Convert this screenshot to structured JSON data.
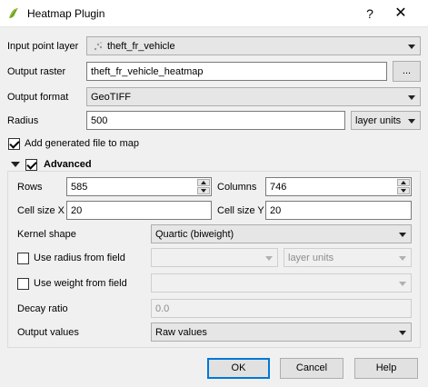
{
  "window": {
    "title": "Heatmap Plugin",
    "help_glyph": "?",
    "close_glyph": "✕"
  },
  "input_layer": {
    "label": "Input point layer",
    "value": "theft_fr_vehicle"
  },
  "output_raster": {
    "label": "Output raster",
    "value": "theft_fr_vehicle_heatmap",
    "browse_label": "..."
  },
  "output_format": {
    "label": "Output format",
    "value": "GeoTIFF"
  },
  "radius": {
    "label": "Radius",
    "value": "500",
    "unit": "layer units"
  },
  "add_to_map": {
    "label": "Add generated file to map",
    "checked": true
  },
  "advanced": {
    "title": "Advanced",
    "checked": true,
    "rows_label": "Rows",
    "rows_value": "585",
    "columns_label": "Columns",
    "columns_value": "746",
    "cellx_label": "Cell size X",
    "cellx_value": "20",
    "celly_label": "Cell size Y",
    "celly_value": "20",
    "kernel_label": "Kernel shape",
    "kernel_value": "Quartic (biweight)",
    "radius_field_label": "Use radius from field",
    "radius_field_checked": false,
    "radius_field_unit": "layer units",
    "weight_field_label": "Use weight from field",
    "weight_field_checked": false,
    "decay_label": "Decay ratio",
    "decay_value": "0.0",
    "output_values_label": "Output values",
    "output_values_value": "Raw values"
  },
  "buttons": {
    "ok": "OK",
    "cancel": "Cancel",
    "help": "Help"
  },
  "colors": {
    "accent": "#0078d7",
    "logo_green": "#8fbc3a"
  }
}
